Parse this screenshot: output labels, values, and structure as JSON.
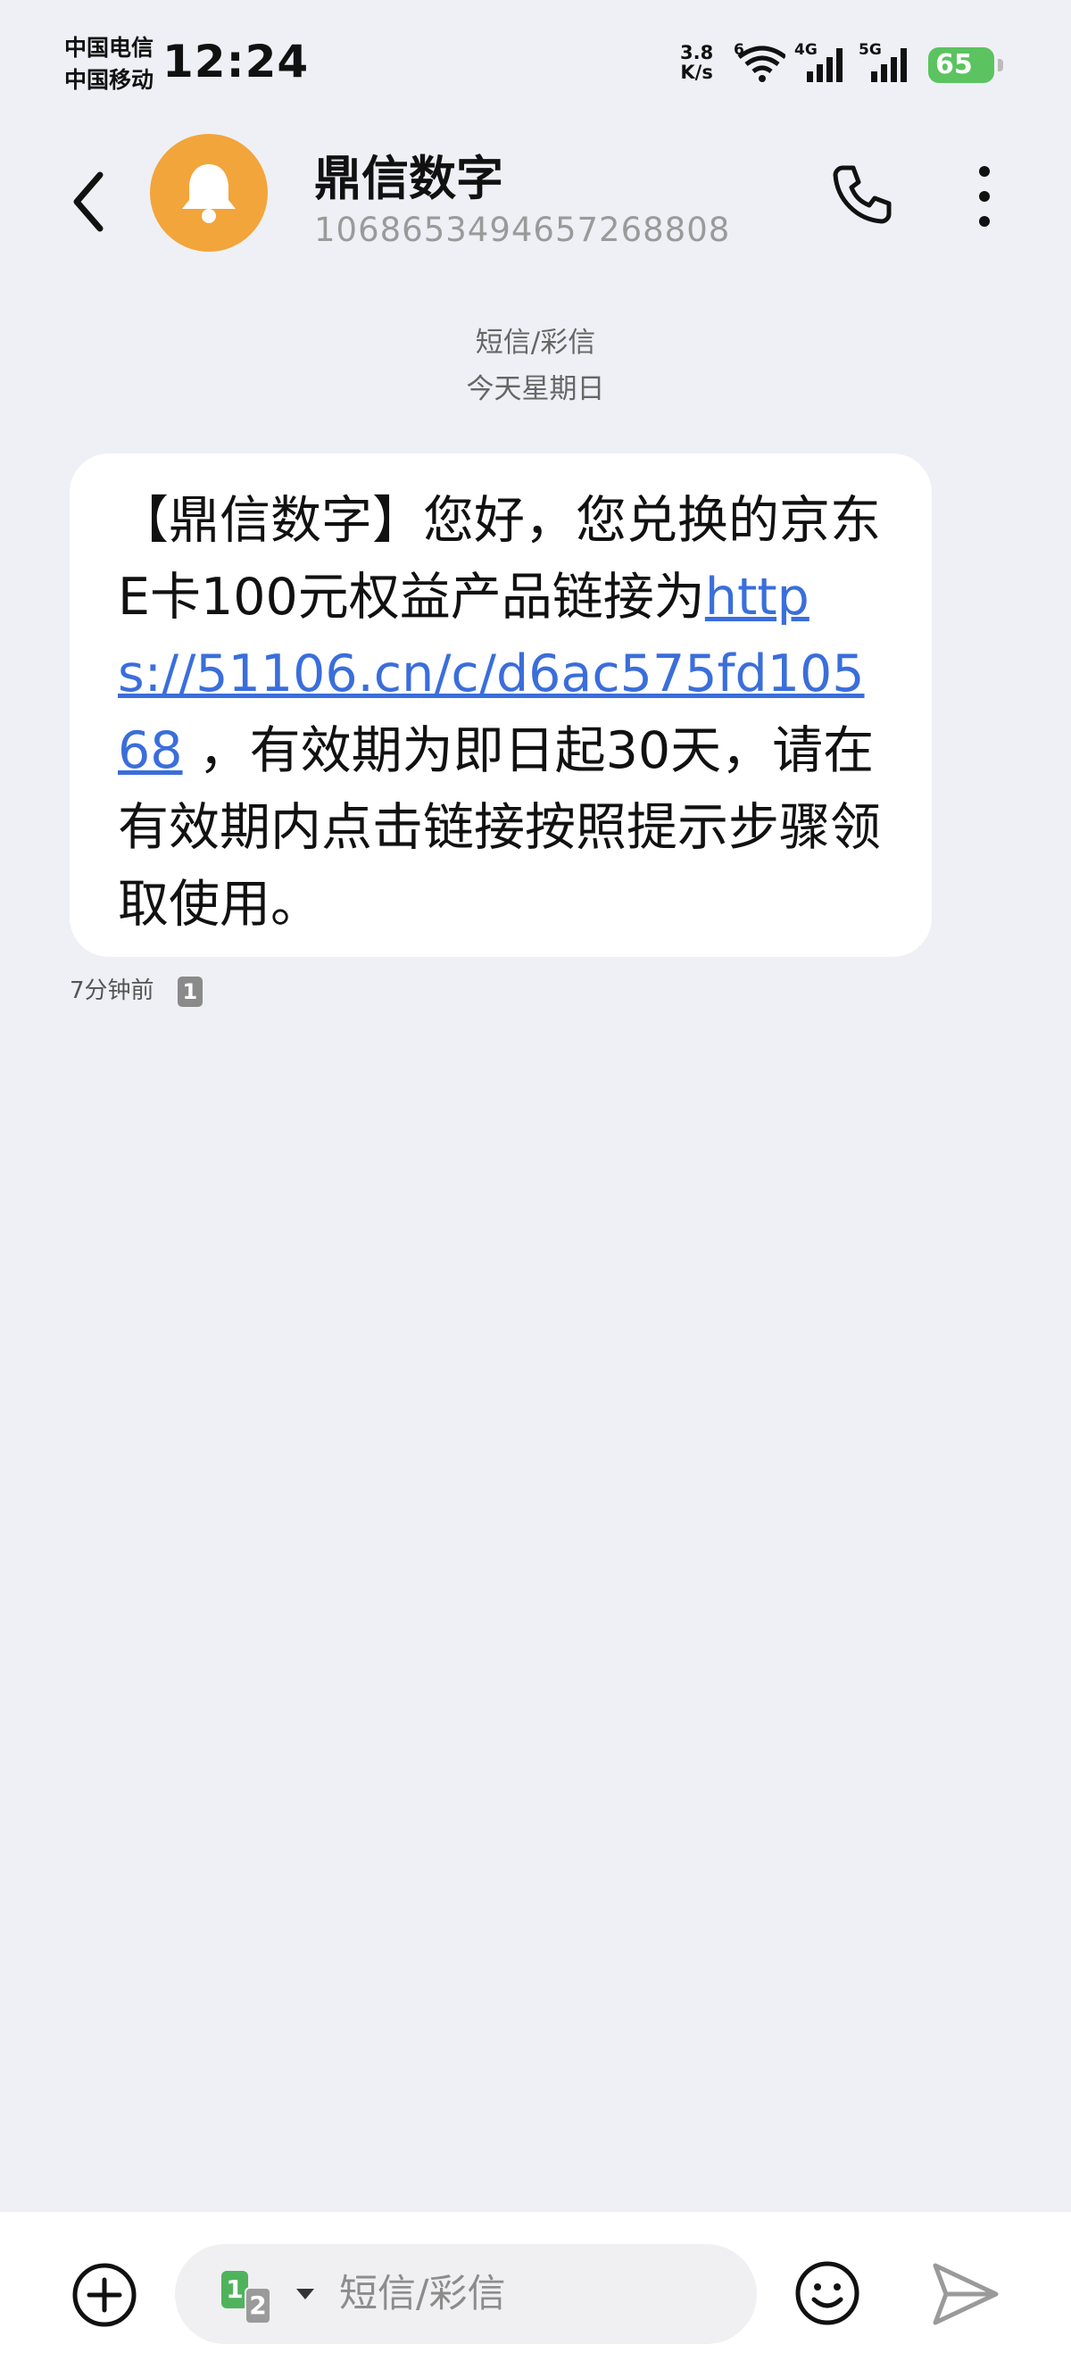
{
  "status_bar": {
    "carrier_1": "中国电信",
    "carrier_2": "中国移动",
    "time": "12:24",
    "net_speed_value": "3.8",
    "net_speed_unit": "K/s",
    "wifi_label": "6",
    "signal_1_label": "4G",
    "signal_2_label": "5G",
    "battery": "65"
  },
  "header": {
    "contact_name": "鼎信数字",
    "contact_number": "1068653494657268808"
  },
  "thread": {
    "type_label": "短信/彩信",
    "date_label": "今天星期日"
  },
  "message": {
    "text_before_link": "【鼎信数字】您好，您兑换的京东E卡100元权益产品链接为",
    "link": "https://51106.cn/c/d6ac575fd10568",
    "text_after_link": " ，有效期为即日起30天，请在有效期内点击链接按照提示步骤领取使用。",
    "time": "7分钟前",
    "sim_slot": "1"
  },
  "input_bar": {
    "sim_1": "1",
    "sim_2": "2",
    "placeholder": "短信/彩信"
  },
  "colors": {
    "background": "#eef0f5",
    "avatar": "#f2a53a",
    "link": "#3a6edb",
    "battery": "#5bc35f",
    "sim_1": "#4fb35c"
  },
  "icons": [
    "back-icon",
    "bell-icon",
    "phone-icon",
    "more-vertical-icon",
    "add-icon",
    "emoji-icon",
    "send-icon",
    "wifi-icon",
    "signal-icon"
  ]
}
